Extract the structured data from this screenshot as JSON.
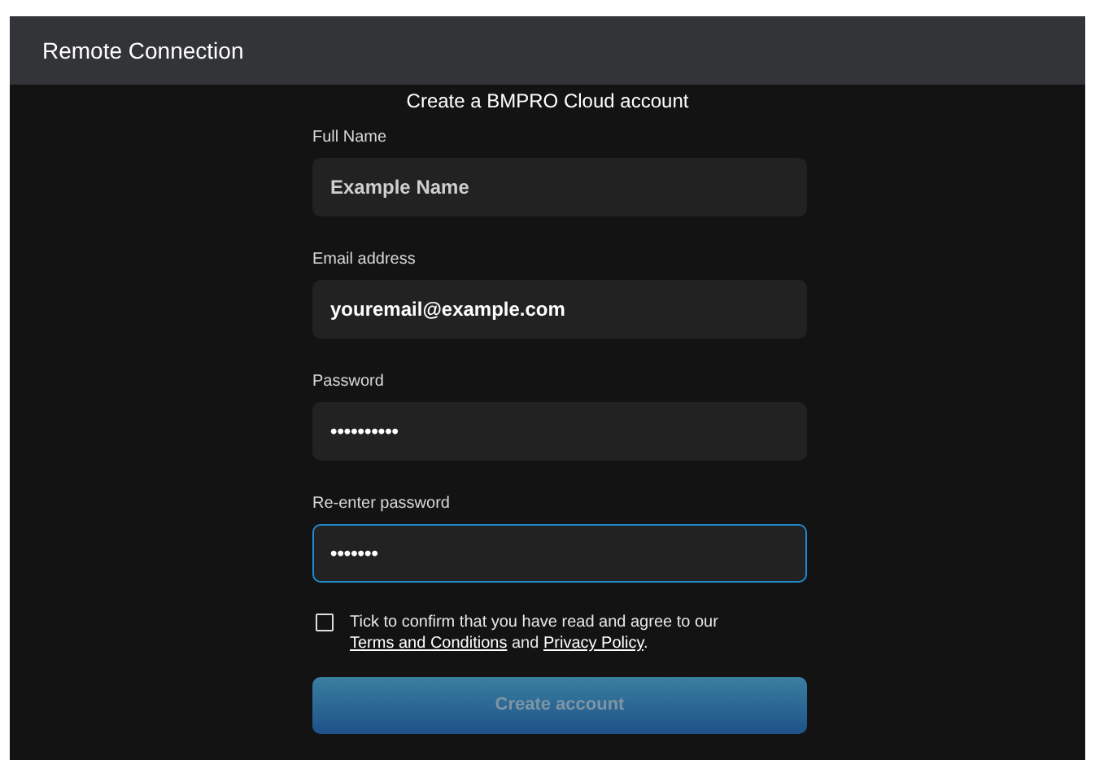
{
  "window": {
    "title": "Remote Connection"
  },
  "heading": "Create a BMPRO Cloud account",
  "fields": [
    {
      "label": "Full Name",
      "placeholder": "Example Name",
      "focused": false
    },
    {
      "label": "Email address",
      "value": "youremail@example.com",
      "focused": false
    },
    {
      "label": "Password",
      "value": "••••••••••",
      "focused": false
    },
    {
      "label": "Re-enter password",
      "value": "•••••••",
      "focused": true
    }
  ],
  "agreement": {
    "checked": false,
    "parts": [
      {
        "kind": "text",
        "text": "Tick to confirm that you have read and agree to our "
      },
      {
        "kind": "link",
        "text": "Terms and Conditions"
      },
      {
        "kind": "text",
        "text": " and "
      },
      {
        "kind": "link",
        "text": "Privacy Policy"
      },
      {
        "kind": "text",
        "text": "."
      }
    ]
  },
  "submit": {
    "label": "Create account",
    "disabled": true
  }
}
